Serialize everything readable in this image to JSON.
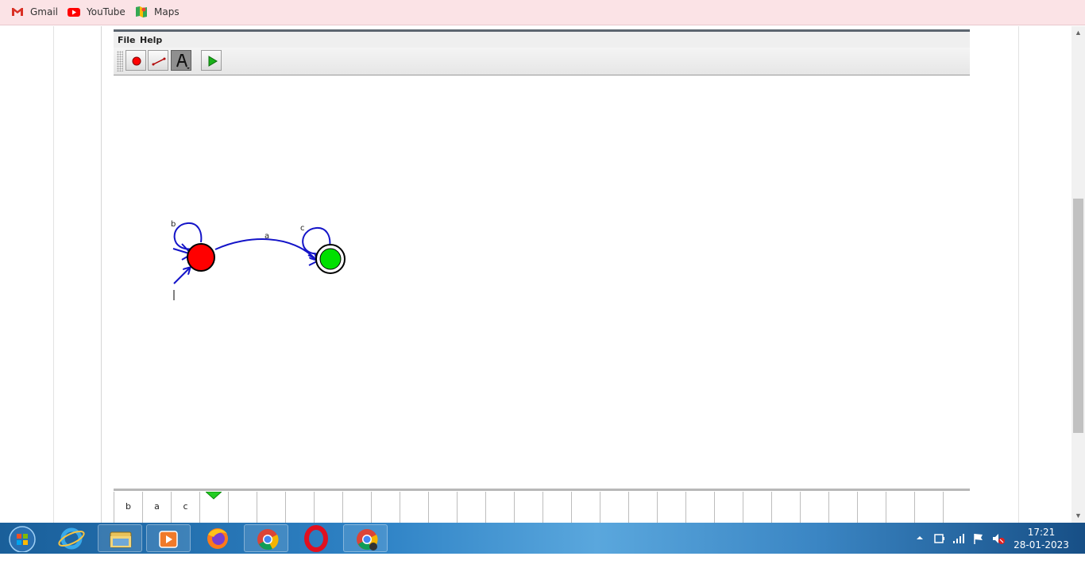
{
  "bookmarks": [
    {
      "label": "Gmail",
      "icon": "gmail-icon"
    },
    {
      "label": "YouTube",
      "icon": "youtube-icon"
    },
    {
      "label": "Maps",
      "icon": "maps-icon"
    }
  ],
  "applet": {
    "menu": [
      "File",
      "Help"
    ],
    "toolbar": [
      {
        "name": "state-tool",
        "icon": "state-circle-icon",
        "active": false
      },
      {
        "name": "transition-tool",
        "icon": "transition-arrow-icon",
        "active": false
      },
      {
        "name": "attribute-editor-tool",
        "icon": "letter-a-icon",
        "active": true
      },
      {
        "name": "run-tool",
        "icon": "play-icon",
        "active": false
      }
    ],
    "automaton": {
      "states": [
        {
          "id": "q0",
          "initial": true,
          "final": false,
          "color": "#ff0000"
        },
        {
          "id": "q1",
          "initial": false,
          "final": true,
          "color": "#00e000"
        }
      ],
      "transitions": [
        {
          "from": "q0",
          "to": "q0",
          "label": "b"
        },
        {
          "from": "q0",
          "to": "q1",
          "label": "a"
        },
        {
          "from": "q1",
          "to": "q1",
          "label": "c"
        }
      ],
      "edge_color": "#1414c8"
    },
    "tape": {
      "cells": [
        "b",
        "a",
        "c",
        "",
        "",
        "",
        "",
        "",
        "",
        "",
        "",
        "",
        "",
        "",
        "",
        "",
        "",
        "",
        "",
        "",
        "",
        "",
        "",
        "",
        "",
        "",
        "",
        "",
        "",
        ""
      ],
      "head_index": 3,
      "head_color": "#22cc22"
    }
  },
  "taskbar": {
    "apps": [
      "start-button",
      "internet-explorer-icon",
      "file-explorer-icon",
      "media-player-icon",
      "firefox-icon",
      "chrome-icon",
      "opera-icon",
      "chrome-active-icon"
    ]
  },
  "clock": {
    "time": "17:21",
    "date": "28-01-2023"
  }
}
